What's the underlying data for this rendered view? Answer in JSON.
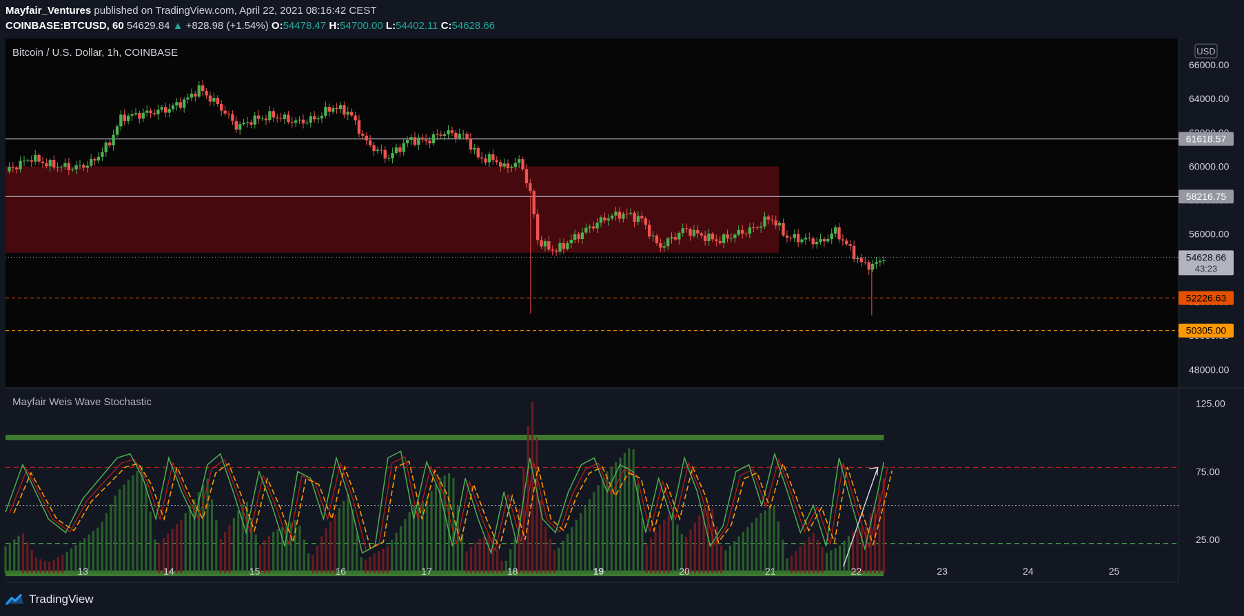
{
  "header": {
    "author": "Mayfair_Ventures",
    "published": " published on TradingView.com, April 22, 2021 08:16:42 CEST",
    "symbol": "COINBASE:BTCUSD, 60",
    "last": "54629.84",
    "change_arrow": "▲",
    "change": "+828.98 (+1.54%)",
    "o_label": "O:",
    "o": "54478.47",
    "h_label": "H:",
    "h": "54700.00",
    "l_label": "L:",
    "l": "54402.11",
    "c_label": "C:",
    "c": "54628.66"
  },
  "footer": {
    "brand": "TradingView",
    "logo_icon": "tradingview-logo-icon"
  },
  "colors": {
    "background": "#131722",
    "pane": "#060606",
    "up": "#4caf50",
    "down": "#ef5350",
    "zone": "#4a0a0e",
    "orange": "#ff9800",
    "orange_dark": "#e65100",
    "gray_tag": "#9598a1"
  },
  "chart_data": [
    {
      "type": "candlestick",
      "title": "Bitcoin / U.S. Dollar, 1h, COINBASE",
      "currency": "USD",
      "ylim": [
        47200,
        67300
      ],
      "y_ticks": [
        "66000.00",
        "64000.00",
        "62000.00",
        "60000.00",
        "58000.00",
        "56000.00",
        "54000.00",
        "52000.00",
        "50000.00",
        "48000.00"
      ],
      "x_ticks": [
        "13",
        "14",
        "15",
        "16",
        "17",
        "18",
        "19",
        "20",
        "21",
        "22",
        "23",
        "24",
        "25"
      ],
      "x_range": [
        12.1,
        25.75
      ],
      "path_x": [
        12.1,
        12.4,
        12.6,
        12.9,
        13.1,
        13.3,
        13.45,
        13.7,
        14.0,
        14.2,
        14.35,
        14.6,
        14.8,
        14.95,
        15.2,
        15.5,
        15.7,
        15.9,
        16.1,
        16.3,
        16.55,
        16.8,
        17.0,
        17.2,
        17.45,
        17.6,
        17.8,
        17.9,
        18.1,
        18.22,
        18.3,
        18.5,
        18.7,
        18.9,
        19.1,
        19.3,
        19.5,
        19.7,
        19.9,
        20.0,
        20.2,
        20.4,
        20.6,
        20.8,
        21.0,
        21.2,
        21.4,
        21.6,
        21.75,
        21.9,
        22.05,
        22.2,
        22.32
      ],
      "path_y": [
        59700,
        60500,
        60100,
        59900,
        60200,
        61300,
        62900,
        63100,
        63400,
        63900,
        64600,
        63500,
        62300,
        62700,
        63000,
        62600,
        62800,
        63500,
        63200,
        61400,
        60500,
        61600,
        61500,
        62000,
        61800,
        60500,
        60400,
        59900,
        60300,
        58100,
        55500,
        55000,
        55700,
        56400,
        57000,
        57200,
        56900,
        55200,
        55900,
        56300,
        55900,
        55600,
        56000,
        56300,
        57000,
        55800,
        55700,
        55500,
        56200,
        55300,
        54300,
        54100,
        54629
      ],
      "horizontal_levels": [
        {
          "value": 61618.57,
          "label": "61618.57",
          "style": "solid",
          "color": "#b2b5be"
        },
        {
          "value": 58216.75,
          "label": "58216.75",
          "style": "solid",
          "color": "#b2b5be"
        },
        {
          "value": 52226.63,
          "label": "52226.63",
          "style": "dashed",
          "color": "#e65100"
        },
        {
          "value": 50305.0,
          "label": "50305.00",
          "style": "dashed",
          "color": "#ff9800"
        }
      ],
      "last_price": {
        "value": 54628.66,
        "label": "54628.66",
        "countdown": "43:23"
      },
      "zone": {
        "x0": 12.1,
        "x1": 21.1,
        "y0": 54900,
        "y1": 60000
      },
      "wicks": [
        {
          "x": 18.21,
          "low": 51300
        },
        {
          "x": 22.18,
          "low": 51200
        }
      ]
    },
    {
      "type": "oscillator",
      "title": "Mayfair Weis Wave Stochastic",
      "ylim": [
        -5,
        135
      ],
      "y_ticks": [
        "125.00",
        "75.00",
        "25.00"
      ],
      "levels": [
        {
          "value": 100,
          "style": "band",
          "color": "#3d7a30"
        },
        {
          "value": 78,
          "style": "dashed",
          "color": "#b71c1c"
        },
        {
          "value": 50,
          "style": "dotted",
          "color": "#9598a1"
        },
        {
          "value": 22,
          "style": "dashed",
          "color": "#4caf50"
        },
        {
          "value": 0,
          "style": "band",
          "color": "#3d7a30"
        }
      ],
      "line_x": [
        12.1,
        12.3,
        12.45,
        12.6,
        12.8,
        13.0,
        13.2,
        13.4,
        13.55,
        13.7,
        13.85,
        14.0,
        14.15,
        14.3,
        14.45,
        14.6,
        14.75,
        14.9,
        15.05,
        15.2,
        15.35,
        15.5,
        15.65,
        15.8,
        15.95,
        16.1,
        16.25,
        16.4,
        16.55,
        16.7,
        16.85,
        17.0,
        17.15,
        17.3,
        17.45,
        17.6,
        17.75,
        17.9,
        18.05,
        18.2,
        18.35,
        18.5,
        18.65,
        18.8,
        18.95,
        19.1,
        19.25,
        19.4,
        19.55,
        19.7,
        19.85,
        20.0,
        20.15,
        20.3,
        20.45,
        20.6,
        20.75,
        20.9,
        21.05,
        21.2,
        21.35,
        21.5,
        21.65,
        21.8,
        21.95,
        22.1,
        22.25,
        22.32
      ],
      "line_y": [
        45,
        80,
        60,
        40,
        30,
        55,
        70,
        85,
        88,
        70,
        40,
        85,
        60,
        40,
        80,
        88,
        60,
        30,
        75,
        50,
        20,
        75,
        70,
        40,
        85,
        55,
        15,
        20,
        85,
        90,
        40,
        82,
        60,
        20,
        70,
        40,
        15,
        60,
        22,
        85,
        40,
        30,
        60,
        80,
        85,
        60,
        80,
        75,
        30,
        70,
        40,
        85,
        60,
        20,
        35,
        75,
        80,
        50,
        88,
        60,
        30,
        50,
        20,
        85,
        50,
        18,
        60,
        82
      ],
      "hist_x": [
        12.1,
        12.3,
        12.45,
        12.6,
        12.8,
        13.0,
        13.2,
        13.4,
        13.55,
        13.7,
        13.85,
        14.0,
        14.15,
        14.3,
        14.45,
        14.6,
        14.75,
        14.9,
        15.05,
        15.2,
        15.35,
        15.5,
        15.65,
        15.8,
        15.95,
        16.1,
        16.25,
        16.4,
        16.55,
        16.7,
        16.85,
        17.0,
        17.15,
        17.3,
        17.45,
        17.6,
        17.75,
        17.9,
        18.05,
        18.2,
        18.25,
        18.35,
        18.5,
        18.65,
        18.8,
        18.95,
        19.1,
        19.25,
        19.4,
        19.55,
        19.7,
        19.85,
        20.0,
        20.15,
        20.3,
        20.45,
        20.6,
        20.75,
        20.9,
        21.05,
        21.2,
        21.35,
        21.5,
        21.65,
        21.8,
        21.95,
        22.1,
        22.25,
        22.32
      ],
      "hist_y": [
        20,
        30,
        12,
        8,
        15,
        25,
        35,
        60,
        70,
        80,
        20,
        30,
        40,
        55,
        70,
        25,
        40,
        55,
        20,
        30,
        35,
        40,
        10,
        30,
        45,
        60,
        8,
        15,
        20,
        35,
        50,
        55,
        70,
        75,
        15,
        25,
        30,
        5,
        30,
        120,
        130,
        40,
        15,
        30,
        45,
        60,
        75,
        85,
        95,
        20,
        35,
        45,
        25,
        40,
        55,
        15,
        25,
        35,
        45,
        50,
        10,
        20,
        30,
        15,
        20,
        30,
        35,
        55,
        70
      ],
      "hist_down": [
        false,
        true,
        true,
        true,
        false,
        false,
        false,
        false,
        false,
        false,
        true,
        true,
        false,
        false,
        false,
        true,
        false,
        false,
        true,
        false,
        false,
        false,
        true,
        true,
        false,
        false,
        true,
        true,
        false,
        false,
        false,
        false,
        false,
        false,
        true,
        true,
        true,
        false,
        true,
        true,
        true,
        true,
        false,
        false,
        false,
        false,
        false,
        false,
        false,
        true,
        true,
        false,
        true,
        true,
        true,
        false,
        false,
        false,
        false,
        false,
        true,
        true,
        true,
        false,
        false,
        true,
        true,
        true,
        true
      ],
      "arrow": {
        "x0": 21.85,
        "y0": 5,
        "x1": 22.25,
        "y1": 78
      }
    }
  ]
}
